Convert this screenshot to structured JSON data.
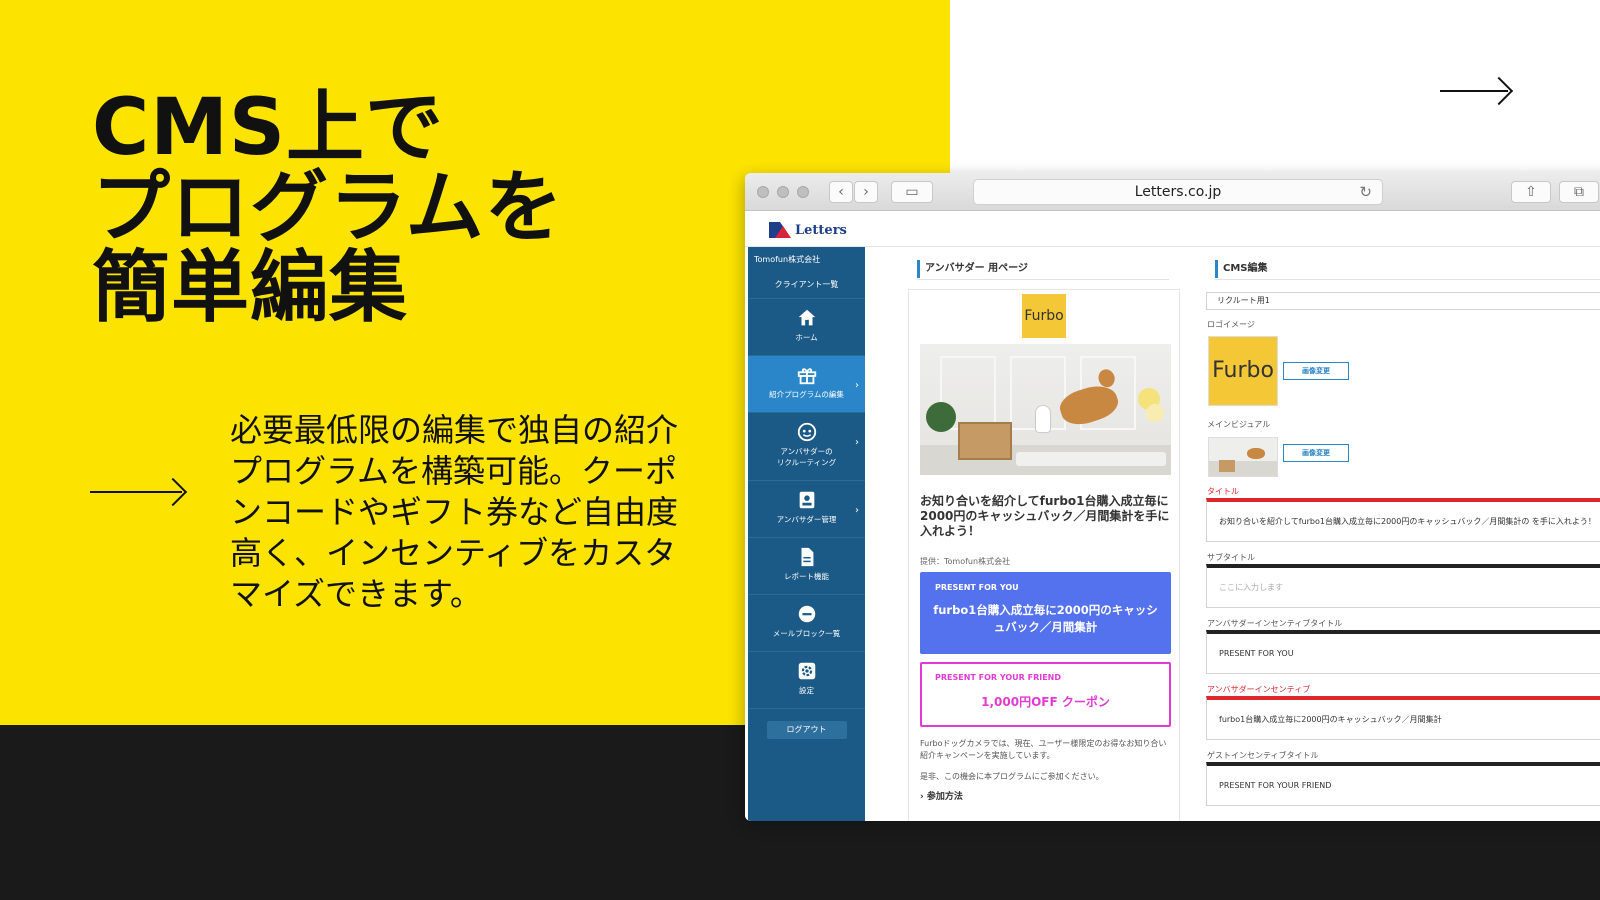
{
  "colors": {
    "accent_yellow": "#fde400",
    "dark_band": "#1a1a1a",
    "sidebar_blue": "#1b5a86",
    "sidebar_active": "#2a86c8",
    "incentive_blue": "#5472ee",
    "friend_magenta": "#e23bd4",
    "required_red": "#e0262d"
  },
  "slide": {
    "headline_lines": [
      "CMS上で",
      "プログラムを",
      "簡単編集"
    ],
    "description": "必要最低限の編集で独自の紹介プログラムを構築可能。クーポンコードやギフト券など自由度高く、インセンティブをカスタマイズできます。",
    "arrow_icon": "right-arrow-icon"
  },
  "browser": {
    "url": "Letters.co.jp",
    "buttons": {
      "back": "‹",
      "forward": "›",
      "sidebar_toggle": "▭",
      "share": "⇧",
      "tabs": "⧉",
      "reload": "↻"
    }
  },
  "app": {
    "logo_text": "Letters",
    "sidebar": {
      "company": "Tomofun株式会社",
      "clients_link": "クライアント一覧",
      "items": [
        {
          "label": "ホーム",
          "icon": "home-icon"
        },
        {
          "label": "紹介プログラムの編集",
          "icon": "gift-icon"
        },
        {
          "label": "アンバサダーの\nリクルーティング",
          "icon": "face-icon"
        },
        {
          "label": "アンバサダー管理",
          "icon": "contact-card-icon"
        },
        {
          "label": "レポート機能",
          "icon": "document-icon"
        },
        {
          "label": "メールブロック一覧",
          "icon": "block-icon"
        },
        {
          "label": "設定",
          "icon": "gear-icon"
        }
      ],
      "logout": "ログアウト"
    },
    "ambassador_page": {
      "heading": "アンバサダー 用ページ",
      "brand_logo": "Furbo",
      "title": "お知り合いを紹介してfurbo1台購入成立毎に2000円のキャッシュバック／月間集計を手に入れよう！",
      "provider": "提供：Tomofun株式会社",
      "you_label": "PRESENT FOR YOU",
      "you_text": "furbo1台購入成立毎に2000円のキャッシュバック／月間集計",
      "friend_label": "PRESENT FOR YOUR FRIEND",
      "friend_text": "1,000円OFF クーポン",
      "body1": "Furboドッグカメラでは、現在、ユーザー様限定のお得なお知り合い紹介キャンペーンを実施しています。",
      "body2": "是非、この機会に本プログラムにご参加ください。",
      "how_to": "› 参加方法"
    },
    "cms": {
      "heading": "CMS編集",
      "recruit_value": "リクルート用1",
      "logo_label": "ロゴイメージ",
      "logo_thumb": "Furbo",
      "change_image": "画像変更",
      "visual_label": "メインビジュアル",
      "title_label": "タイトル",
      "title_value": "お知り合いを紹介してfurbo1台購入成立毎に2000円のキャッシュバック／月間集計の を手に入れよう！",
      "subtitle_label": "サブタイトル",
      "subtitle_placeholder": "ここに入力します",
      "amb_incentive_title_label": "アンバサダーインセンティブタイトル",
      "amb_incentive_title_value": "PRESENT FOR YOU",
      "amb_incentive_label": "アンバサダーインセンティブ",
      "amb_incentive_value": "furbo1台購入成立毎に2000円のキャッシュバック／月間集計",
      "guest_incentive_title_label": "ゲストインセンティブタイトル",
      "guest_incentive_title_value": "PRESENT FOR YOUR FRIEND"
    }
  }
}
